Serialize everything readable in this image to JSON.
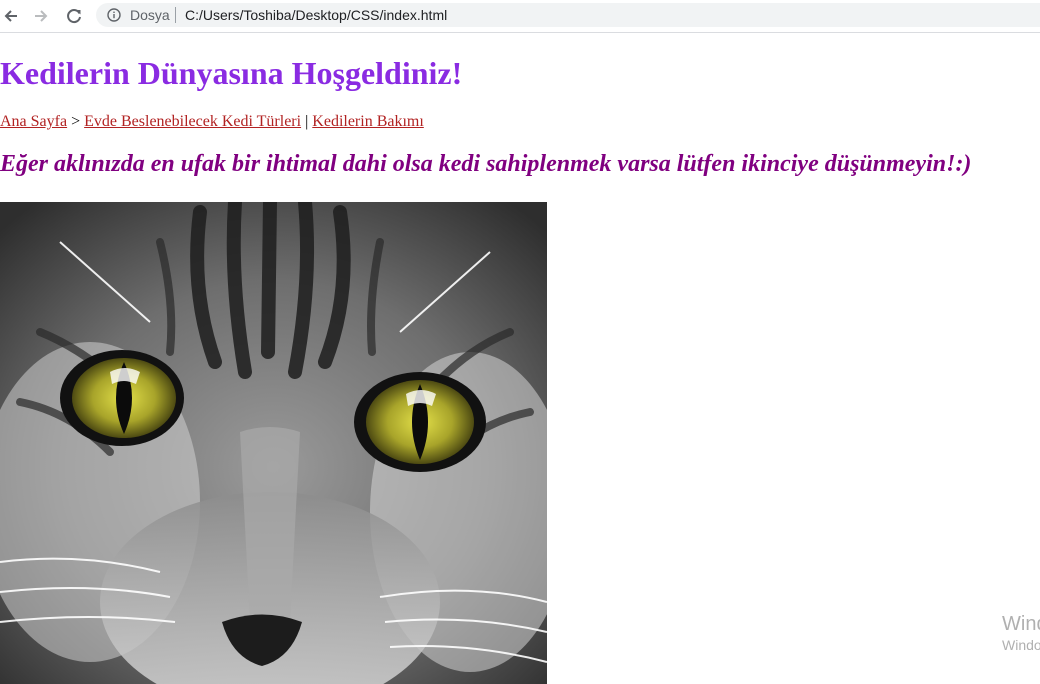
{
  "browser": {
    "site_label": "Dosya",
    "url": "C:/Users/Toshiba/Desktop/CSS/index.html",
    "icons": [
      "back-arrow-icon",
      "forward-arrow-icon",
      "reload-icon",
      "info-icon"
    ]
  },
  "page": {
    "title": "Kedilerin Dünyasına Hoşgeldiniz!",
    "breadcrumb": {
      "home_link": "Ana Sayfa",
      "arrow": " > ",
      "breeds_link": "Evde Beslenebilecek Kedi Türleri",
      "divider": " | ",
      "care_link": "Kedilerin Bakımı"
    },
    "subtitle": "Eğer aklınızda en ufak bir ihtimal dahi olsa kedi sahiplenmek varsa lütfen ikinciye düşünmeyin!:)",
    "colors": {
      "title": "#8a2be2",
      "subtitle": "#800080",
      "links": "#b22222"
    }
  },
  "watermark": {
    "line1": "Wind",
    "line2": "Windo"
  }
}
